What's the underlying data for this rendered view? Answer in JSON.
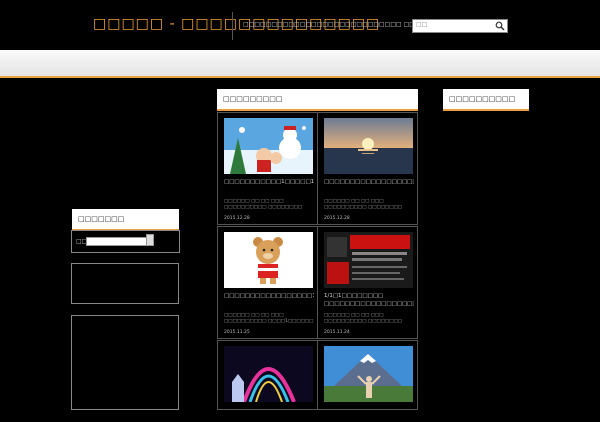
{
  "header": {
    "site_title": "□□□□□ - □□□□□□□□□□□□□□",
    "tagline": "□□□□□□□□□□□□□□□□□□□□□□□□□□□□ □□□□□□",
    "search_placeholder": "□□"
  },
  "main": {
    "heading": "□□□□□□□□□",
    "cards": [
      {
        "title": "□□□□□□□□□□□1□□□□□1□4□□□□□□□□□□□□□□□□□□□□□□□□□□□□□",
        "excerpt": "□□□□□□ □□ □□ □□□ □□□□□□□□□□ □□□□□□□□ □□□□□□",
        "date": "2015.12.28"
      },
      {
        "title": "□□□□□□□□□□□□□□□□□□□□□□□□□□□□□□□□□□□□□□□□□",
        "excerpt": "□□□□□□ □□ □□ □□□ □□□□□□□□□□ □□□□□□□□ □□□□□□",
        "date": "2015.12.28"
      },
      {
        "title": "□□□□□□□□□□□□□□□□□1□□□□□□□□□□□□□□□□□□□",
        "excerpt": "□□□□□□ □□ □□ □□□ □□□□□□□□□□ □□□□1□□□□□□",
        "date": "2015.11.25"
      },
      {
        "title": "1/1□1□□□□□□□□ □□□□□□□□□□□□□□□□□□□□□□□□□□□□□□□□□□",
        "excerpt": "□□□□□□ □□ □□ □□□ □□□□□□□□□□ □□□□□□□□ □□□□□□",
        "date": "2015.11.24"
      },
      {
        "title": "",
        "excerpt": "",
        "date": ""
      },
      {
        "title": "",
        "excerpt": "",
        "date": ""
      }
    ]
  },
  "sidebar_left": {
    "heading": "□□□□□□□",
    "search_label": "□□"
  },
  "sidebar_right": {
    "heading": "□□□□□□□□□□"
  }
}
